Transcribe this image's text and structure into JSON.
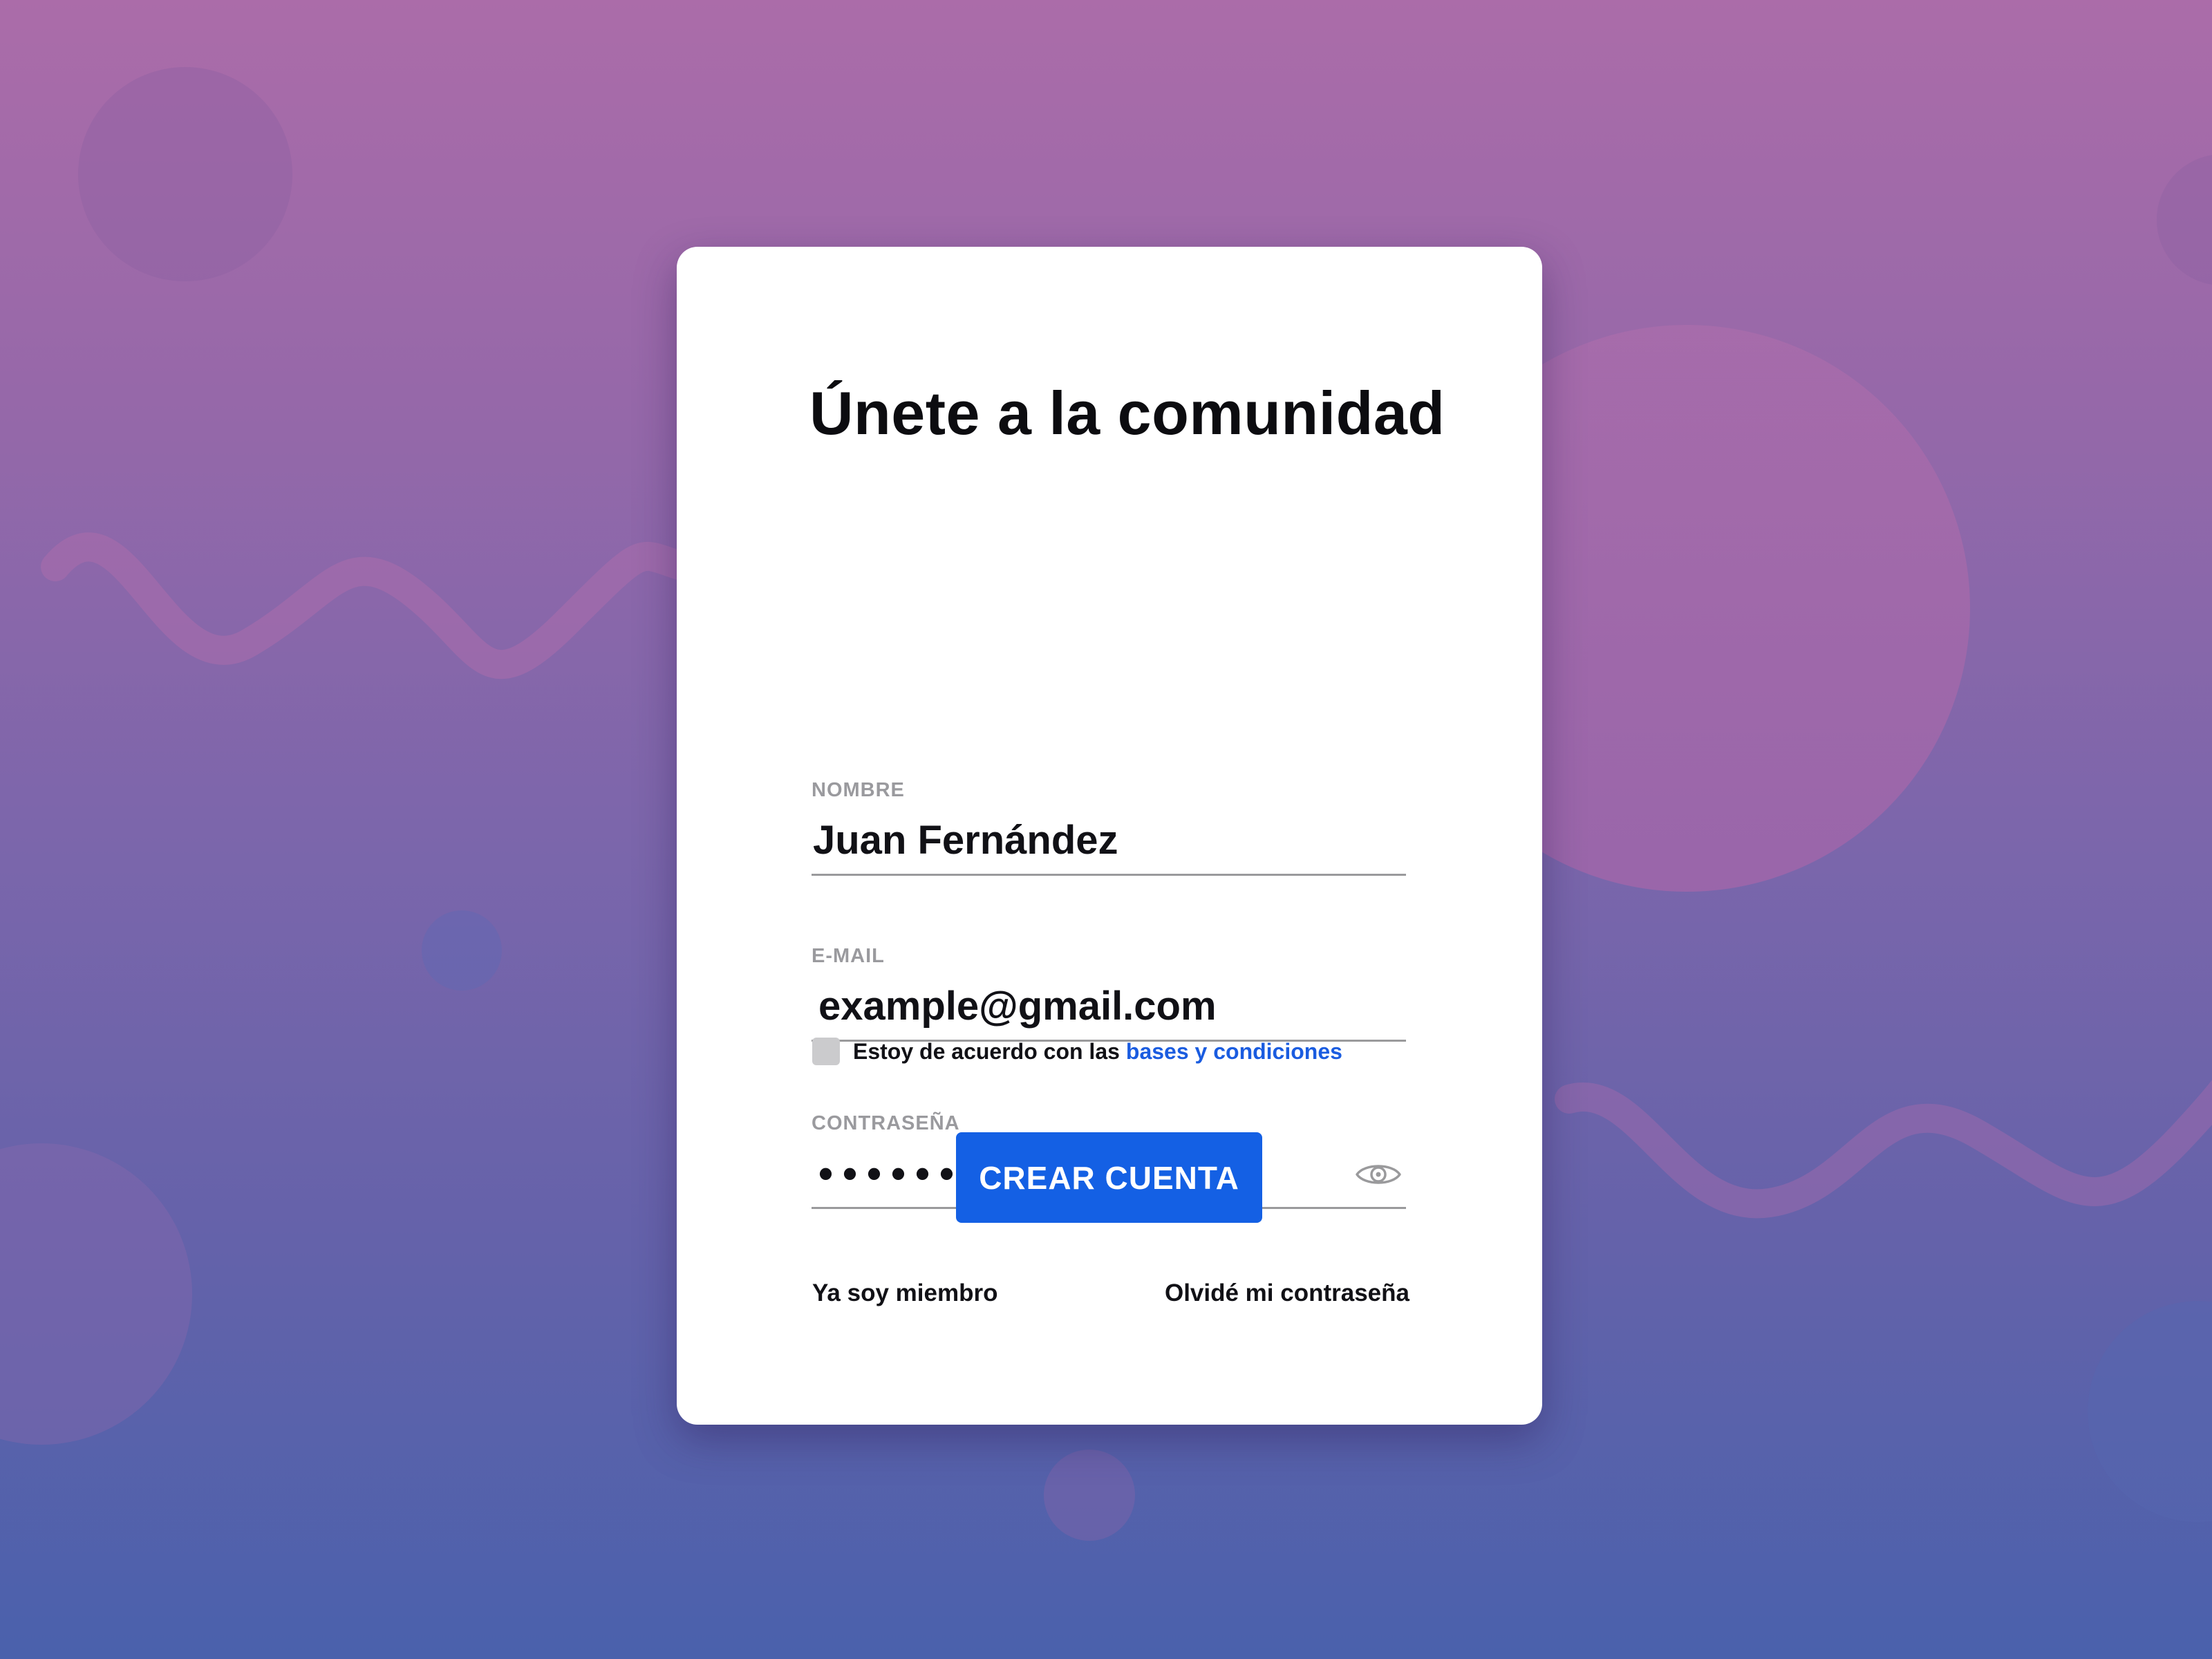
{
  "page": {
    "background_top": "#ab6ca9",
    "background_bottom": "#4a61ac"
  },
  "signup": {
    "title": "Únete a la comunidad",
    "name_field": {
      "label": "NOMBRE",
      "value": "Juan Fernández"
    },
    "email_field": {
      "label": "E-MAIL",
      "value": "example@gmail.com"
    },
    "password_field": {
      "label": "CONTRASEÑA",
      "value": "•••••••••",
      "toggle_icon": "eye-icon"
    },
    "terms": {
      "checked": false,
      "text": "Estoy de acuerdo con las",
      "link_text": "bases y condiciones",
      "link_color": "#1a5ce0"
    },
    "submit_label": "CREAR CUENTA",
    "submit_color": "#1460e4",
    "member_link": "Ya soy miembro",
    "forgot_link": "Olvidé mi contraseña"
  }
}
